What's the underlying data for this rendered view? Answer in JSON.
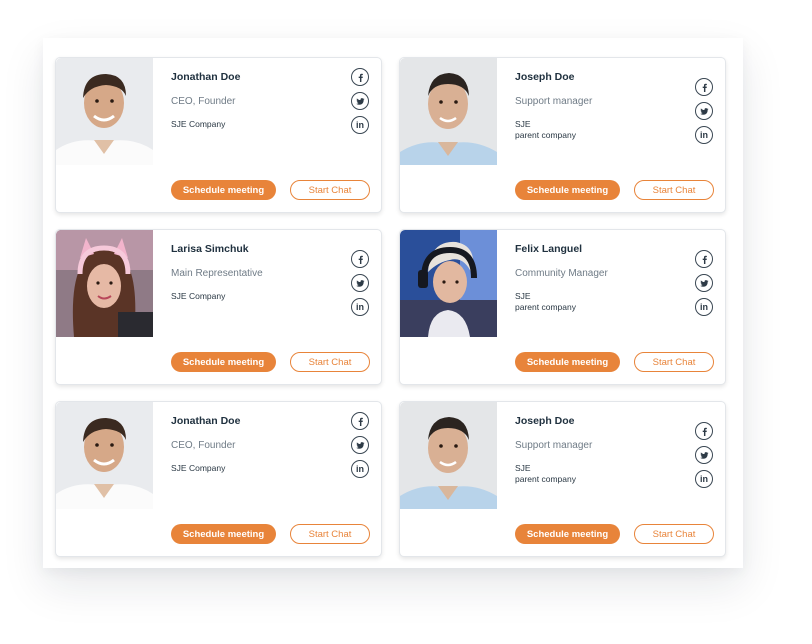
{
  "cards": [
    {
      "name": "Jonathan Doe",
      "role": "CEO, Founder",
      "company": "SJE Company",
      "schedule_label": "Schedule meeting",
      "chat_label": "Start Chat",
      "social": [
        "facebook-icon",
        "twitter-icon",
        "linkedin-icon"
      ]
    },
    {
      "name": "Joseph Doe",
      "role": "Support manager",
      "company": "SJE\nparent company",
      "schedule_label": "Schedule meeting",
      "chat_label": "Start Chat",
      "social": [
        "facebook-icon",
        "twitter-icon",
        "linkedin-icon"
      ]
    },
    {
      "name": "Larisa Simchuk",
      "role": "Main Representative",
      "company": "SJE Company",
      "schedule_label": "Schedule meeting",
      "chat_label": "Start Chat",
      "social": [
        "facebook-icon",
        "twitter-icon",
        "linkedin-icon"
      ]
    },
    {
      "name": "Felix Languel",
      "role": "Community Manager",
      "company": "SJE\nparent company",
      "schedule_label": "Schedule meeting",
      "chat_label": "Start Chat",
      "social": [
        "facebook-icon",
        "twitter-icon",
        "linkedin-icon"
      ]
    },
    {
      "name": "Jonathan Doe",
      "role": "CEO, Founder",
      "company": "SJE Company",
      "schedule_label": "Schedule meeting",
      "chat_label": "Start Chat",
      "social": [
        "facebook-icon",
        "twitter-icon",
        "linkedin-icon"
      ]
    },
    {
      "name": "Joseph Doe",
      "role": "Support manager",
      "company": "SJE\nparent company",
      "schedule_label": "Schedule meeting",
      "chat_label": "Start Chat",
      "social": [
        "facebook-icon",
        "twitter-icon",
        "linkedin-icon"
      ]
    }
  ],
  "colors": {
    "accent": "#e8843a",
    "name_text": "#20313f",
    "role_text": "#6f7b86",
    "card_border": "#e3e6ea"
  }
}
